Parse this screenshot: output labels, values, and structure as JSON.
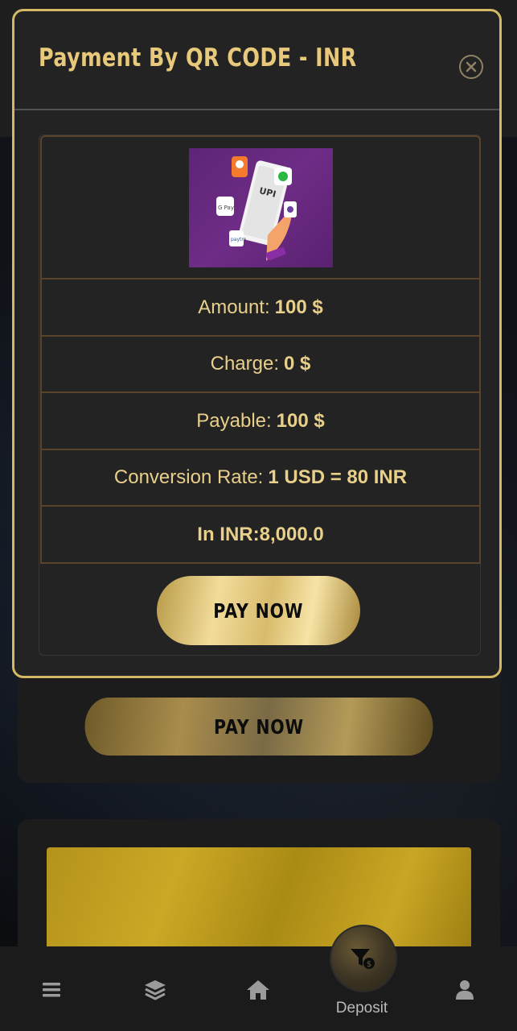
{
  "modal": {
    "title": "Payment By QR CODE - INR",
    "close_icon": "close-circle-icon",
    "qr_image_alt": "UPI payment apps illustration",
    "rows": [
      {
        "label": "Amount:",
        "value": "100 $"
      },
      {
        "label": "Charge:",
        "value": "0 $"
      },
      {
        "label": "Payable:",
        "value": "100 $"
      },
      {
        "label": "Conversion Rate:",
        "value": "1 USD = 80 INR"
      }
    ],
    "inr_total": "In INR:8,000.0",
    "pay_button": "PAY NOW"
  },
  "background": {
    "pay_button": "PAY NOW"
  },
  "bottom_nav": {
    "items": [
      {
        "name": "menu",
        "icon": "menu-icon"
      },
      {
        "name": "layers",
        "icon": "layers-icon"
      },
      {
        "name": "home",
        "icon": "home-icon"
      },
      {
        "name": "deposit",
        "icon": "deposit-filter-icon",
        "label": "Deposit"
      },
      {
        "name": "profile",
        "icon": "user-icon"
      }
    ]
  },
  "colors": {
    "gold": "#e8c97b",
    "modal_bg": "#232324",
    "border_gold": "#d4b866",
    "row_border": "#5a432b"
  }
}
